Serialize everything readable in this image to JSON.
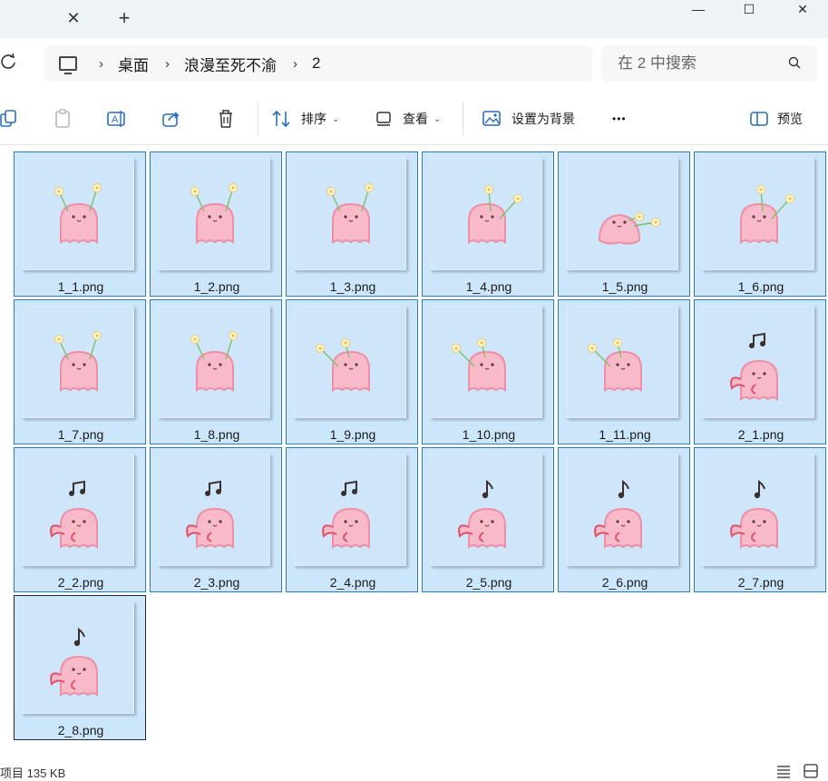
{
  "titlebar": {
    "close_tab_glyph": "✕",
    "new_tab_glyph": "+"
  },
  "window_controls": {
    "minimize": "—",
    "maximize": "☐",
    "close": "✕"
  },
  "address": {
    "crumbs": [
      "桌面",
      "浪漫至死不渝",
      "2"
    ],
    "separator": "›"
  },
  "search": {
    "placeholder": "在 2 中搜索"
  },
  "toolbar": {
    "sort_label": "排序",
    "view_label": "查看",
    "set_background_label": "设置为背景",
    "more_label": "•••",
    "preview_label": "预览"
  },
  "files": [
    {
      "name": "1_1.png",
      "art": "flower",
      "variant": 0
    },
    {
      "name": "1_2.png",
      "art": "flower",
      "variant": 0
    },
    {
      "name": "1_3.png",
      "art": "flower",
      "variant": 0
    },
    {
      "name": "1_4.png",
      "art": "flower",
      "variant": 1
    },
    {
      "name": "1_5.png",
      "art": "flower",
      "variant": 2
    },
    {
      "name": "1_6.png",
      "art": "flower",
      "variant": 1
    },
    {
      "name": "1_7.png",
      "art": "flower",
      "variant": 0
    },
    {
      "name": "1_8.png",
      "art": "flower",
      "variant": 0
    },
    {
      "name": "1_9.png",
      "art": "flower",
      "variant": 3
    },
    {
      "name": "1_10.png",
      "art": "flower",
      "variant": 3
    },
    {
      "name": "1_11.png",
      "art": "flower",
      "variant": 3
    },
    {
      "name": "2_1.png",
      "art": "music",
      "variant": 0
    },
    {
      "name": "2_2.png",
      "art": "music",
      "variant": 0
    },
    {
      "name": "2_3.png",
      "art": "music",
      "variant": 0
    },
    {
      "name": "2_4.png",
      "art": "music",
      "variant": 0
    },
    {
      "name": "2_5.png",
      "art": "music",
      "variant": 1
    },
    {
      "name": "2_6.png",
      "art": "music",
      "variant": 1
    },
    {
      "name": "2_7.png",
      "art": "music",
      "variant": 1
    },
    {
      "name": "2_8.png",
      "art": "music",
      "variant": 1
    }
  ],
  "status": {
    "text": "项目 135 KB"
  },
  "colors": {
    "accent": "#2a7bbf",
    "tile_bg": "#cce6fb",
    "ghost": "#f8b9c8",
    "ghost_outline": "#ee8fa6"
  }
}
